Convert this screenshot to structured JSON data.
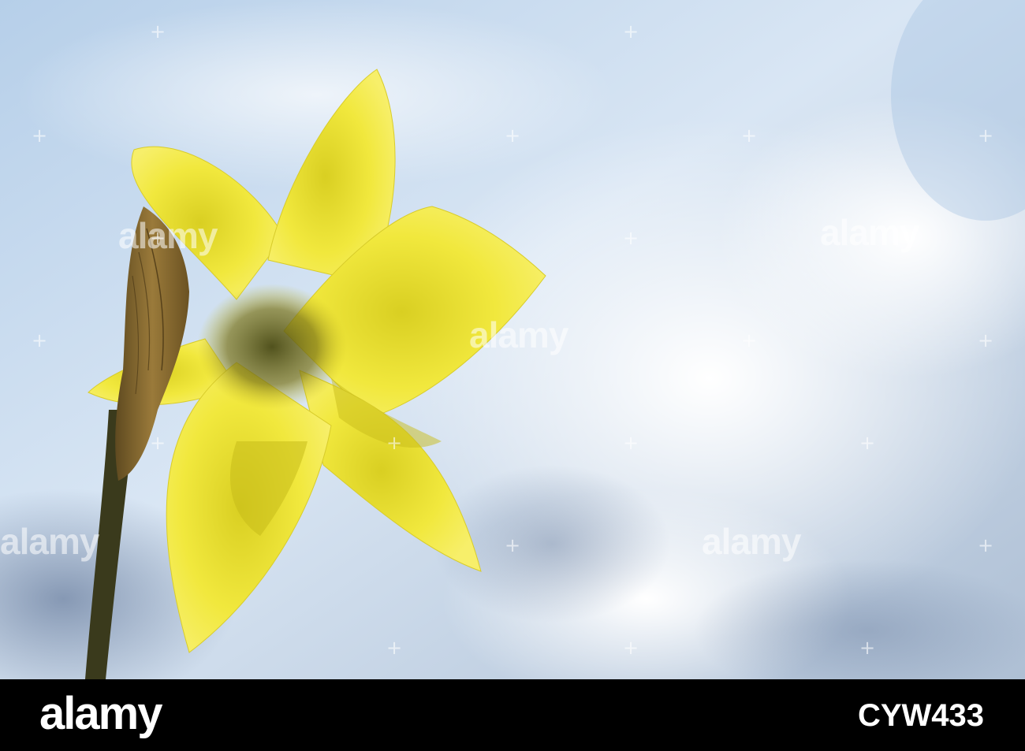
{
  "photo": {
    "subject": "daffodil-icon",
    "sky_color": "#a9c6e6",
    "cloud_color": "#f4f7fb",
    "petal_color": "#f3e83a",
    "stem_color": "#3c3a1e"
  },
  "watermark": {
    "text": "alamy"
  },
  "footer": {
    "logo": "alamy",
    "image_id": "CYW433"
  }
}
